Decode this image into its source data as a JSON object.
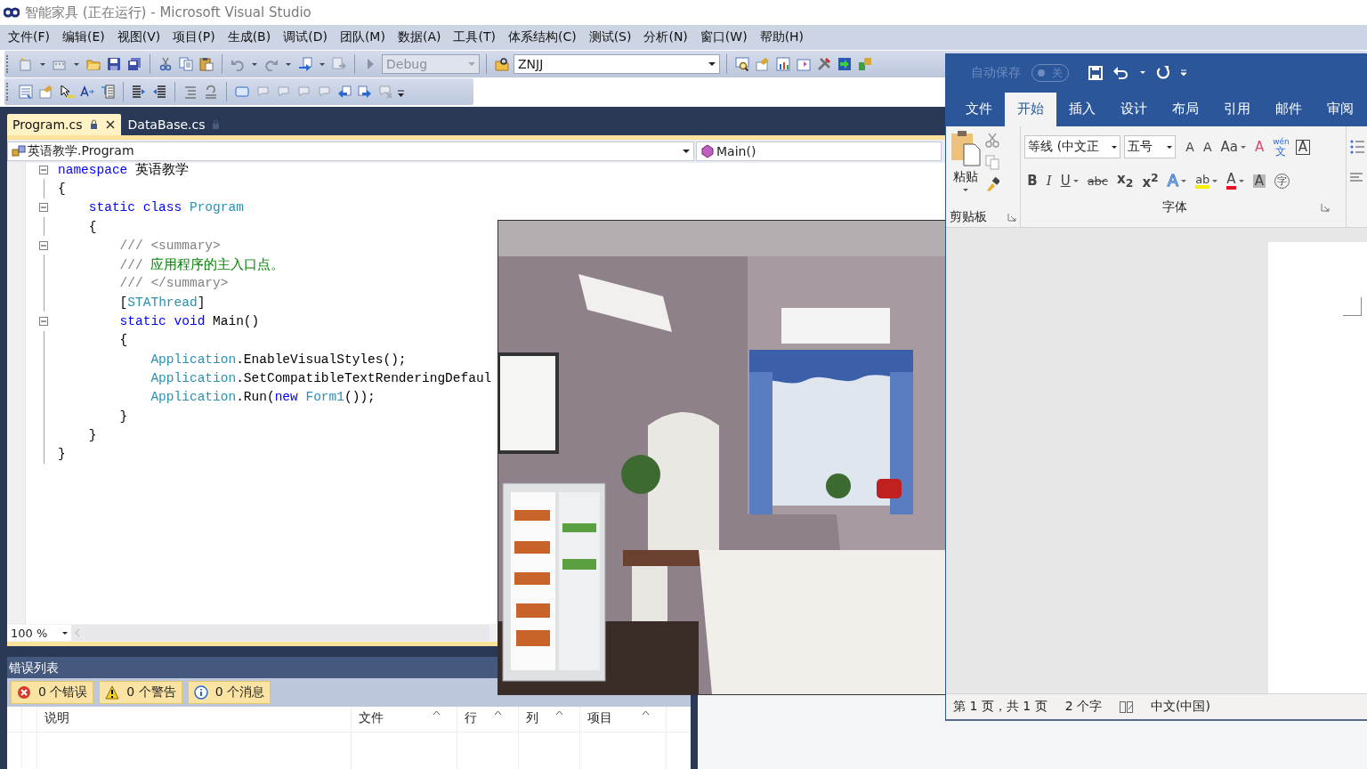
{
  "window": {
    "title": "智能家具 (正在运行) - Microsoft Visual Studio"
  },
  "menu": [
    "文件(F)",
    "编辑(E)",
    "视图(V)",
    "项目(P)",
    "生成(B)",
    "调试(D)",
    "团队(M)",
    "数据(A)",
    "工具(T)",
    "体系结构(C)",
    "测试(S)",
    "分析(N)",
    "窗口(W)",
    "帮助(H)"
  ],
  "toolbar": {
    "configuration": "Debug",
    "project": "ZNJJ"
  },
  "tabs": [
    {
      "label": "Program.cs",
      "selected": true
    },
    {
      "label": "DataBase.cs",
      "selected": false
    }
  ],
  "nav_bar": {
    "type": "英语教学.Program",
    "member": "Main()"
  },
  "code_lines": [
    {
      "fold": true,
      "tokens": [
        {
          "text": "namespace",
          "kind": "keyword"
        },
        {
          "text": " 英语教学",
          "kind": "plain"
        }
      ]
    },
    {
      "fold": false,
      "tokens": [
        {
          "text": "{",
          "kind": "plain"
        }
      ]
    },
    {
      "fold": true,
      "tokens": [
        {
          "text": "    static class",
          "kind": "keyword"
        },
        {
          "text": " Program",
          "kind": "type"
        }
      ]
    },
    {
      "fold": false,
      "tokens": [
        {
          "text": "    {",
          "kind": "plain"
        }
      ]
    },
    {
      "fold": true,
      "tokens": [
        {
          "text": "        /// <summary>",
          "kind": "doc"
        }
      ]
    },
    {
      "fold": false,
      "tokens": [
        {
          "text": "        ///",
          "kind": "doc"
        },
        {
          "text": " 应用程序的主入口点。",
          "kind": "comment"
        }
      ]
    },
    {
      "fold": false,
      "tokens": [
        {
          "text": "        /// </summary>",
          "kind": "doc"
        }
      ]
    },
    {
      "fold": false,
      "tokens": [
        {
          "text": "        [",
          "kind": "plain"
        },
        {
          "text": "STAThread",
          "kind": "type"
        },
        {
          "text": "]",
          "kind": "plain"
        }
      ]
    },
    {
      "fold": true,
      "tokens": [
        {
          "text": "        static void",
          "kind": "keyword"
        },
        {
          "text": " Main()",
          "kind": "plain"
        }
      ]
    },
    {
      "fold": false,
      "tokens": [
        {
          "text": "        {",
          "kind": "plain"
        }
      ]
    },
    {
      "fold": false,
      "tokens": [
        {
          "text": "            Application",
          "kind": "type"
        },
        {
          "text": ".EnableVisualStyles();",
          "kind": "plain"
        }
      ]
    },
    {
      "fold": false,
      "tokens": [
        {
          "text": "            Application",
          "kind": "type"
        },
        {
          "text": ".SetCompatibleTextRenderingDefaul",
          "kind": "plain"
        }
      ]
    },
    {
      "fold": false,
      "tokens": [
        {
          "text": "            Application",
          "kind": "type"
        },
        {
          "text": ".Run(",
          "kind": "plain"
        },
        {
          "text": "new",
          "kind": "keyword"
        },
        {
          "text": " Form1",
          "kind": "type"
        },
        {
          "text": "());",
          "kind": "plain"
        }
      ]
    },
    {
      "fold": false,
      "tokens": [
        {
          "text": "        }",
          "kind": "plain"
        }
      ]
    },
    {
      "fold": false,
      "tokens": [
        {
          "text": "    }",
          "kind": "plain"
        }
      ]
    },
    {
      "fold": false,
      "tokens": [
        {
          "text": "}",
          "kind": "plain"
        }
      ]
    }
  ],
  "zoom": "100 %",
  "error_list": {
    "title": "错误列表",
    "filters": [
      {
        "kind": "error",
        "label": "0 个错误"
      },
      {
        "kind": "warning",
        "label": "0 个警告"
      },
      {
        "kind": "info",
        "label": "0 个消息"
      }
    ],
    "columns": [
      "说明",
      "文件",
      "行",
      "列",
      "项目"
    ]
  },
  "word": {
    "autosave": {
      "label": "自动保存",
      "state": "关",
      "on": false
    },
    "tabs": [
      {
        "label": "文件",
        "selected": false
      },
      {
        "label": "开始",
        "selected": true
      },
      {
        "label": "插入",
        "selected": false
      },
      {
        "label": "设计",
        "selected": false
      },
      {
        "label": "布局",
        "selected": false
      },
      {
        "label": "引用",
        "selected": false
      },
      {
        "label": "邮件",
        "selected": false
      },
      {
        "label": "审阅",
        "selected": false
      }
    ],
    "paste": "粘贴",
    "font": "等线 (中文正",
    "size": "五号",
    "font_row1": [
      {
        "kind": "grow",
        "text": "A"
      },
      {
        "kind": "shrink",
        "text": "A"
      },
      {
        "kind": "case",
        "text": "Aa"
      },
      {
        "kind": "clear",
        "text": "A"
      },
      {
        "kind": "phonetic",
        "text": "wén",
        "sub": "文"
      },
      {
        "kind": "border",
        "text": "A"
      }
    ],
    "font_row2": [
      {
        "kind": "bold",
        "text": "B"
      },
      {
        "kind": "italic",
        "text": "I"
      },
      {
        "kind": "underline",
        "text": "U"
      },
      {
        "kind": "strike",
        "text": "abc"
      },
      {
        "kind": "sub",
        "text": "x$_{2}$"
      },
      {
        "kind": "super",
        "text": "x$^{2}$"
      },
      {
        "kind": "effect",
        "text": "A"
      },
      {
        "kind": "highlight",
        "text": "ab"
      },
      {
        "kind": "color",
        "text": "A"
      },
      {
        "kind": "shading",
        "text": "A"
      },
      {
        "kind": "enclose",
        "text": "字"
      }
    ],
    "groups": [
      "剪贴板",
      "字体"
    ],
    "status": [
      "第 1 页，共 1 页",
      "2 个字",
      "中文(中国)"
    ]
  }
}
